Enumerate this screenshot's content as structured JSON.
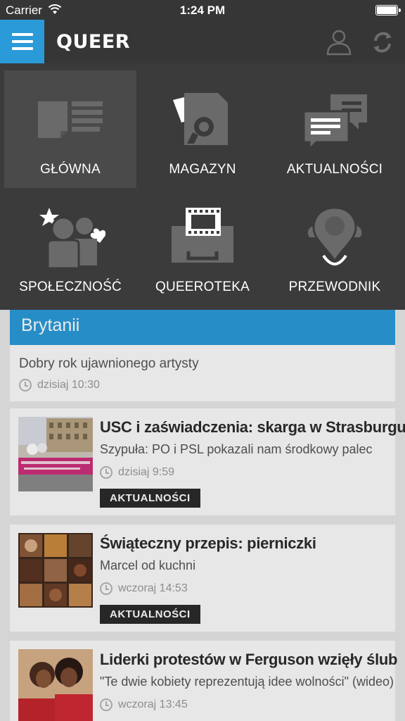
{
  "status": {
    "carrier": "Carrier",
    "time": "1:24 PM"
  },
  "header": {
    "logo": "QUEER"
  },
  "nav": [
    {
      "label": "GŁÓWNA",
      "icon": "home-news-icon",
      "active": true
    },
    {
      "label": "MAGAZYN",
      "icon": "magazine-icon"
    },
    {
      "label": "AKTUALNOŚCI",
      "icon": "news-chat-icon"
    },
    {
      "label": "SPOŁECZNOŚĆ",
      "icon": "community-icon"
    },
    {
      "label": "QUEEROTEKA",
      "icon": "film-box-icon"
    },
    {
      "label": "PRZEWODNIK",
      "icon": "map-pin-icon"
    }
  ],
  "featured": {
    "title_fragment": "Brytanii",
    "subtitle": "Dobry rok ujawnionego artysty",
    "time": "dzisiaj 10:30"
  },
  "articles": [
    {
      "title": "USC i zaświadczenia: skarga w Strasburgu!",
      "subtitle": "Szypuła: PO i PSL pokazali nam środkowy palec",
      "time": "dzisiaj 9:59",
      "tag": "AKTUALNOŚCI"
    },
    {
      "title": "Świąteczny przepis: pierniczki",
      "subtitle": "Marcel od kuchni",
      "time": "wczoraj 14:53",
      "tag": "AKTUALNOŚCI"
    },
    {
      "title": "Liderki protestów w Ferguson wzięły ślub",
      "subtitle": "\"Te dwie kobiety reprezentują idee wolności\" (wideo)",
      "time": "wczoraj 13:45"
    }
  ],
  "colors": {
    "accent": "#2b9ad8",
    "menu_bg": "#3b3b3b",
    "header_bg": "#363636"
  }
}
